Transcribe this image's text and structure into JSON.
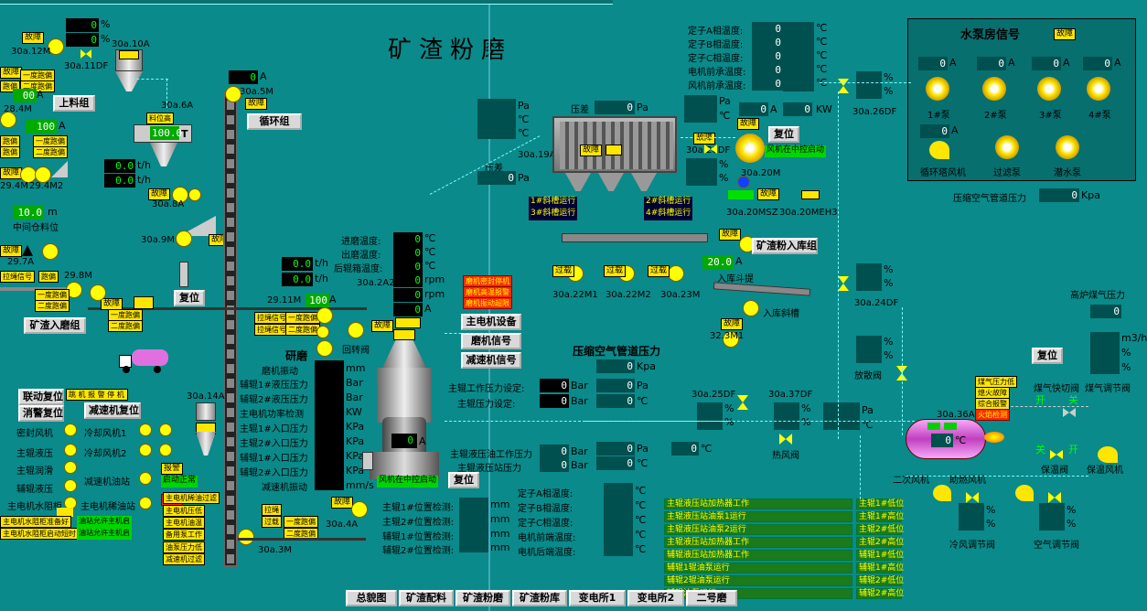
{
  "title": "矿渣粉磨",
  "top_left": {
    "v_12M": "0",
    "v_11DF": "0",
    "lbl_12M": "30a.12M",
    "lbl_11DF": "30a.11DF",
    "lbl_10A": "30a.10A",
    "fault": "故障",
    "unit_pct": "%",
    "unit_A": "A"
  },
  "pump_panel": {
    "title": "水泵房信号",
    "fault": "故障",
    "currents": [
      "0",
      "0",
      "0",
      "0"
    ],
    "pumps": [
      "1#泵",
      "2#泵",
      "3#泵",
      "4#泵"
    ],
    "fan_current": "0",
    "bottom_labels": [
      "循环塔风机",
      "过滤泵",
      "潜水泵"
    ],
    "air_pressure_label": "压缩空气管道压力",
    "air_pressure_value": "0",
    "air_pressure_unit": "Kpa"
  },
  "motor_temps": {
    "labels": [
      "定子A相温度:",
      "定子B相温度:",
      "定子C相温度:",
      "电机前承温度:",
      "风机前承温度:"
    ],
    "values": [
      "0",
      "0",
      "0",
      "0",
      "0"
    ],
    "unit": "℃"
  },
  "buttons": {
    "upper_feed": "上料组",
    "circulation": "循环组",
    "slag_to_mill": "矿渣入磨组",
    "reset": "复位",
    "slag_powder_to_silo": "矿渣粉入库组",
    "main_motor_equipment": "主电机设备",
    "mill_signal": "磨机信号",
    "reducer_signal": "减速机信号",
    "linkage_reset": "联动复位",
    "fire_reset": "消警复位",
    "reducer_reset": "减速机复位"
  },
  "nav": [
    "总貌图",
    "矿渣配料",
    "矿渣粉磨",
    "矿渣粉库",
    "变电所1",
    "变电所2",
    "二号磨"
  ],
  "labels_misc": {
    "l_2A": "30a.2A2",
    "l_19A": "30a.19A",
    "l_20DF": "30a.20DF",
    "l_20M": "30a.20M",
    "l_20MSZ": "30a.20MSZ",
    "l_20MEH3": "30a.20MEH3",
    "l_26DF": "30a.26DF",
    "l_24DF": "30a.24DF",
    "l_22M1": "30a.22M1",
    "l_22M2": "30a.22M2",
    "l_23M": "30a.23M",
    "l_323M": "32.3M1",
    "l_25DF": "30a.25DF",
    "l_37DF": "30a.37DF",
    "l_36A": "30a.36A",
    "l_14A": "30a.14A",
    "l_4A": "30a.4A",
    "l_3M": "30a.3M",
    "l_9M": "30a.9M",
    "l_8A": "30a.8A",
    "l_6A": "30a.6A",
    "l_5M": "30a.5M",
    "l_29M": "29.11M",
    "l_298": "29.8M",
    "l_297": "29.7A",
    "l_294": "29.4M",
    "l_2942": "29.4M2",
    "l_284": "28.4M",
    "mid_bin": "中间仓料位",
    "ctrl_center": "风机在中控启动",
    "compressed_air": "压缩空气管道压力",
    "blast_gas": "高炉煤气压力",
    "main_pressure_set": "主辊工作压力设定:",
    "aux_pressure_set": "主辊压力设定:",
    "main_work_p": "主辊液压油工作压力",
    "main_dest_p": "主辊液压站压力",
    "cold_valve": "冷风调节阀",
    "air_valve": "空气调节阀",
    "hot_valve": "热风阀",
    "secondary_fan": "二次风机",
    "assist_fan": "助燃风机",
    "gas_valve": "煤气调节阀",
    "gas_quick": "煤气快切阀",
    "silo_hopper": "入库斗提",
    "silo_chute": "入库斜槽",
    "vent_valve": "放散阀",
    "mill_label": "研磨",
    "tempA": "定子A相温度:",
    "tempB": "定子B相温度:",
    "tempC": "定子C相温度:",
    "motor_front": "电机前端温度:",
    "motor_rear": "电机后端温度:",
    "pos1": "主辊1#位置检测:",
    "pos2": "主辊2#位置检测:",
    "pos3": "辅辊1#位置检测:",
    "pos4": "辅辊2#位置检测:",
    "inlet_temp": "进磨温度:",
    "outlet_temp": "出磨温度:",
    "after_temp": "后辊箱温度:",
    "mill_vib": "磨机振动",
    "aux1_press": "辅辊1#液压压力",
    "aux2_press": "辅辊2#液压压力",
    "main_power": "主电机功率检测",
    "main1_in": "主辊1#入口压力",
    "main2_in": "主辊2#入口压力",
    "aux1_in": "辅辊1#入口压力",
    "aux2_in": "辅辊2#入口压力",
    "reducer_vib": "减速机振动",
    "pressure_diff": "压差",
    "slide_valve": "回转阀"
  },
  "left_values": {
    "v1": "00",
    "v2": "100",
    "v3": "0.0",
    "v4": "0.0",
    "v5": "10.0",
    "v6": "100.0",
    "v7": "0.0",
    "v8": "0.0",
    "v9": "100"
  },
  "equipment_list": {
    "items": [
      "密封风机",
      "主辊液压",
      "主辊润滑",
      "辅辊液压",
      "主电机水阻柜"
    ],
    "items2": [
      "冷却风机1",
      "冷却风机2",
      "减速机油站",
      "主电机稀油站"
    ]
  },
  "green_status": [
    "主辊液压站加热器工作",
    "主辊液压站油泵1运行",
    "主辊液压站油泵2运行",
    "主辊液压站加热器工作",
    "辅辊液压站加热器工作",
    "辅辊1辊油泵运行",
    "辅辊2辊油泵运行",
    "辅辊油泵运行",
    "主辊1#低位",
    "主辊1#高位",
    "主辊2#低位",
    "主辊2#高位",
    "辅辊1#低位",
    "辅辊1#高位",
    "辅辊2#低位",
    "辅辊2#高位"
  ],
  "readouts": {
    "zero": "0",
    "pa": "Pa",
    "kpa": "Kpa",
    "bar": "Bar",
    "kw": "KW",
    "degC": "℃",
    "mm": "mm",
    "rpm": "rpm",
    "th": "t/h",
    "m": "m",
    "m3h": "m3/h",
    "twenty": "20.0",
    "hundred": "100"
  }
}
